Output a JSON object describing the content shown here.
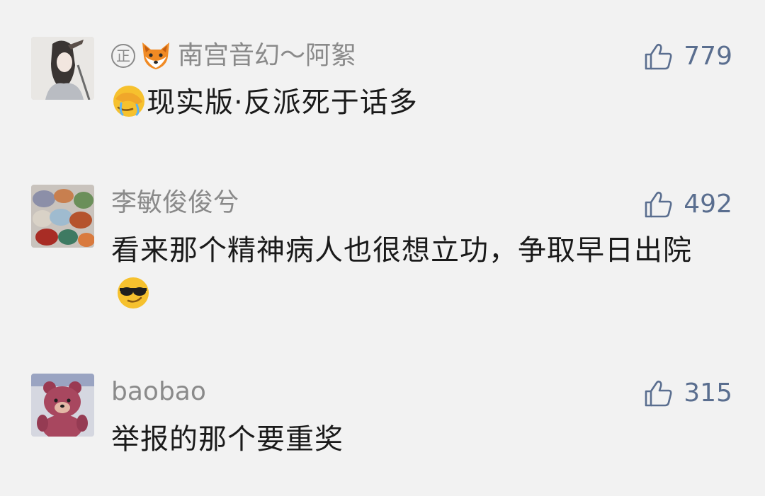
{
  "comments": [
    {
      "badge": "正",
      "nickname": "南宫音幻～阿絮",
      "likes": "779",
      "text_before": "",
      "text": "现实版·反派死于话多",
      "emoji_leading": "face-palm-crying-emoji",
      "emoji_trailing": ""
    },
    {
      "badge": "",
      "nickname": "李敏俊俊兮",
      "likes": "492",
      "text": "看来那个精神病人也很想立功，争取早日出院",
      "emoji_leading": "",
      "emoji_trailing": "sunglasses-smirk-emoji"
    },
    {
      "badge": "",
      "nickname": "baobao",
      "likes": "315",
      "text": "举报的那个要重奖",
      "emoji_leading": "",
      "emoji_trailing": ""
    }
  ],
  "colors": {
    "background": "#f2f2f2",
    "nickname": "#8a8a8a",
    "like": "#5a6e8f",
    "text": "#1a1a1a"
  }
}
